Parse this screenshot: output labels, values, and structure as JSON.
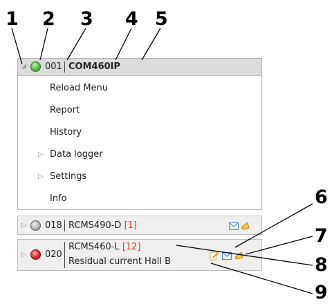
{
  "callouts": [
    "1",
    "2",
    "3",
    "4",
    "5",
    "6",
    "7",
    "8",
    "9"
  ],
  "device_main": {
    "status_color": "green",
    "address": "001",
    "name": "COM460IP",
    "menu": [
      {
        "label": "Reload Menu",
        "submenu": false
      },
      {
        "label": "Report",
        "submenu": false
      },
      {
        "label": "History",
        "submenu": false
      },
      {
        "label": "Data logger",
        "submenu": true
      },
      {
        "label": "Settings",
        "submenu": true
      },
      {
        "label": "Info",
        "submenu": false
      }
    ]
  },
  "device_rows": [
    {
      "status_color": "gray",
      "address": "018",
      "name": "RCMS490-D",
      "count": "[1]",
      "description": ""
    },
    {
      "status_color": "red",
      "address": "020",
      "name": "RCMS460-L",
      "count": "[12]",
      "description": "Residual current Hall B"
    }
  ],
  "icons": [
    "edit-icon",
    "mail-icon",
    "horn-icon"
  ],
  "colors": {
    "header_bg": "#dcdcdc",
    "row_bg": "#efefef",
    "alarm_red": "#e8332c"
  }
}
